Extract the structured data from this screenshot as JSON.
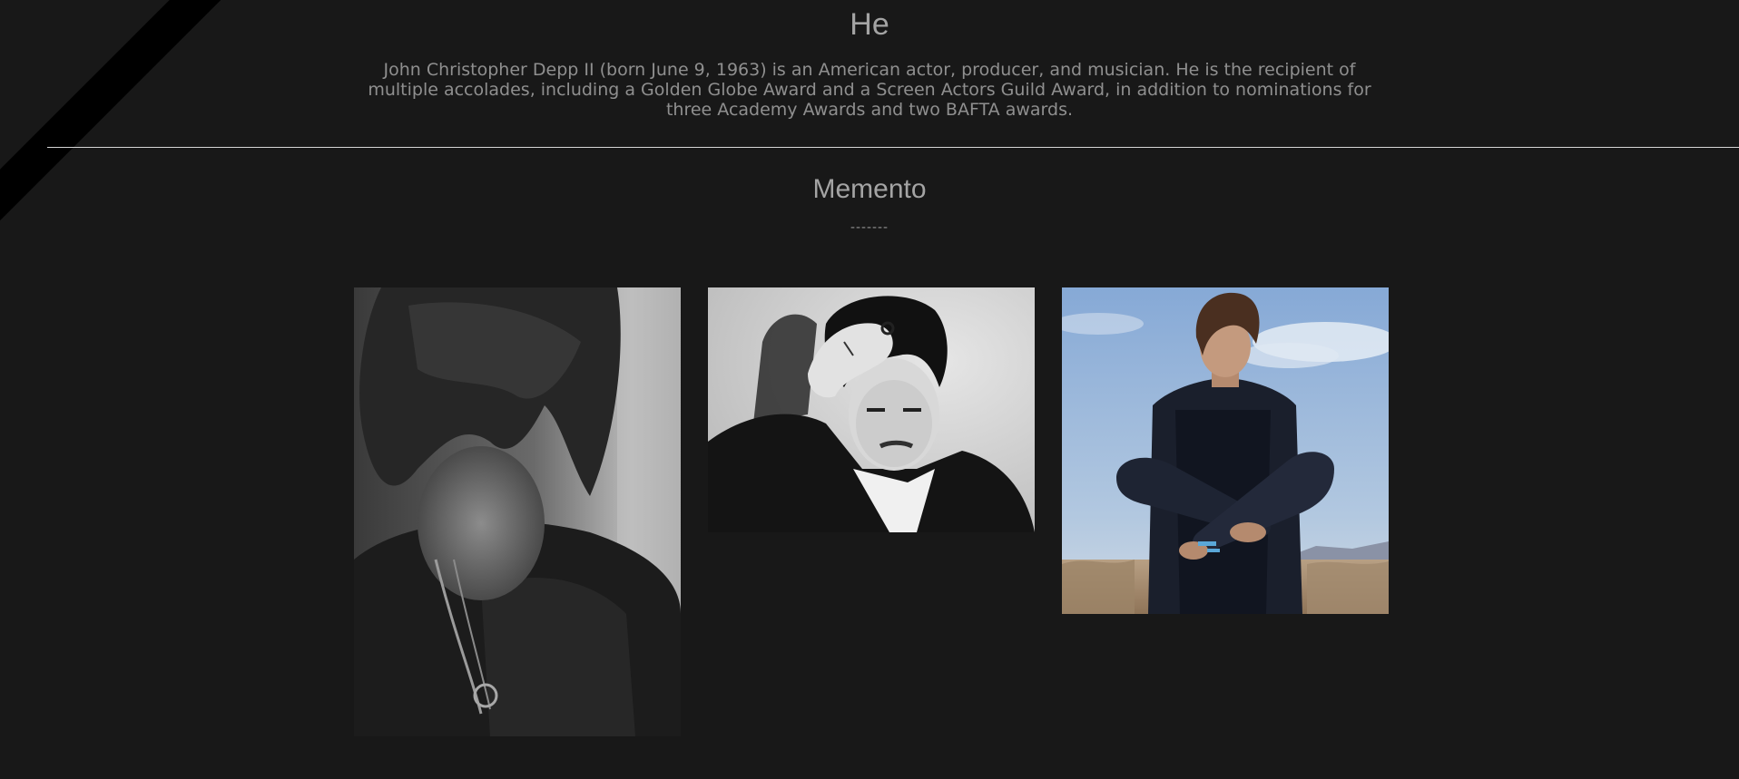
{
  "header": {
    "title": "He",
    "bio": "John Christopher Depp II (born June 9, 1963) is an American actor, producer, and musician. He is the recipient of multiple accolades, including a Golden Globe Award and a Screen Actors Guild Award, in addition to nominations for three Academy Awards and two BAFTA awards."
  },
  "memento": {
    "title": "Memento",
    "dashes": "-------"
  },
  "colors": {
    "background": "#181818",
    "text": "#a4a4a4",
    "ribbon": "#000000",
    "divider": "#d6d6d6"
  },
  "gallery": {
    "photos": [
      {
        "description": "black-and-white portrait, head bowed, long hair, necklaces"
      },
      {
        "description": "black-and-white portrait, hand on head, rings"
      },
      {
        "description": "color photo, dark shirt, desert and sky background"
      }
    ]
  }
}
